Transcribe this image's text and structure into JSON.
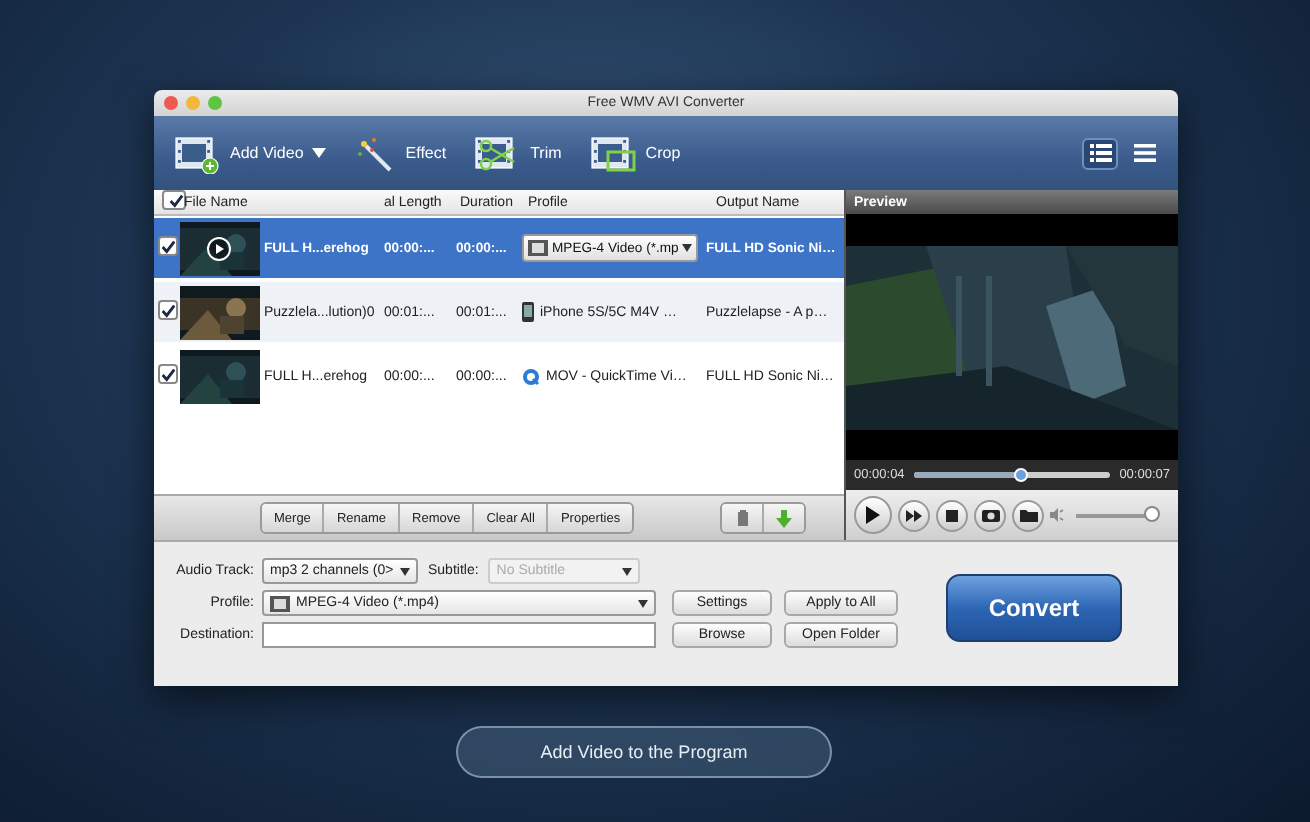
{
  "window": {
    "title": "Free WMV AVI Converter"
  },
  "toolbar": [
    {
      "label": "Add Video",
      "kind": "add",
      "menu": true
    },
    {
      "label": "Effect",
      "kind": "effect",
      "menu": false
    },
    {
      "label": "Trim",
      "kind": "trim",
      "menu": false
    },
    {
      "label": "Crop",
      "kind": "crop",
      "menu": false
    }
  ],
  "views": [
    {
      "kind": "detail",
      "selected": true
    },
    {
      "kind": "list",
      "selected": false
    }
  ],
  "table": {
    "all_checked": true,
    "columns": [
      "File Name",
      "al Length",
      "Duration",
      "Profile",
      "Output Name"
    ],
    "rows": [
      {
        "checked": true,
        "selected": true,
        "file_name": "FULL H...erehog",
        "length": "00:00:...",
        "duration": "00:00:...",
        "kind": "mpeg4",
        "profile": "MPEG-4 Video (*.mp",
        "output_name": "FULL HD Sonic  Ni…"
      },
      {
        "checked": true,
        "selected": false,
        "file_name": "Puzzlela...lution)0",
        "length": "00:01:...",
        "duration": "00:01:...",
        "kind": "iphone",
        "profile": "iPhone 5S/5C M4V …",
        "output_name": "Puzzlelapse - A p…"
      },
      {
        "checked": true,
        "selected": false,
        "file_name": "FULL H...erehog",
        "length": "00:00:...",
        "duration": "00:00:...",
        "kind": "mov",
        "profile": "MOV - QuickTime Vi…",
        "output_name": "FULL HD Sonic  Ni…"
      }
    ]
  },
  "actions": [
    "Merge",
    "Rename",
    "Remove",
    "Clear All",
    "Properties"
  ],
  "preview": {
    "title": "Preview",
    "current_time": "00:00:04",
    "total_time": "00:00:07",
    "seek": {
      "level": 0.55
    },
    "volume": {
      "level": 1
    }
  },
  "settings": {
    "audio_track": {
      "label": "Audio Track:",
      "value": "mp3 2 channels (0>"
    },
    "subtitle": {
      "label": "Subtitle:",
      "value": "No Subtitle",
      "disabled": true
    },
    "profile": {
      "label": "Profile:",
      "value": "MPEG-4 Video (*.mp4)"
    },
    "destination": {
      "label": "Destination:"
    },
    "buttons": [
      "Settings",
      "Apply to All",
      "Browse",
      "Open Folder"
    ]
  },
  "convert": "Convert",
  "add_video_button": "Add Video to the Program"
}
